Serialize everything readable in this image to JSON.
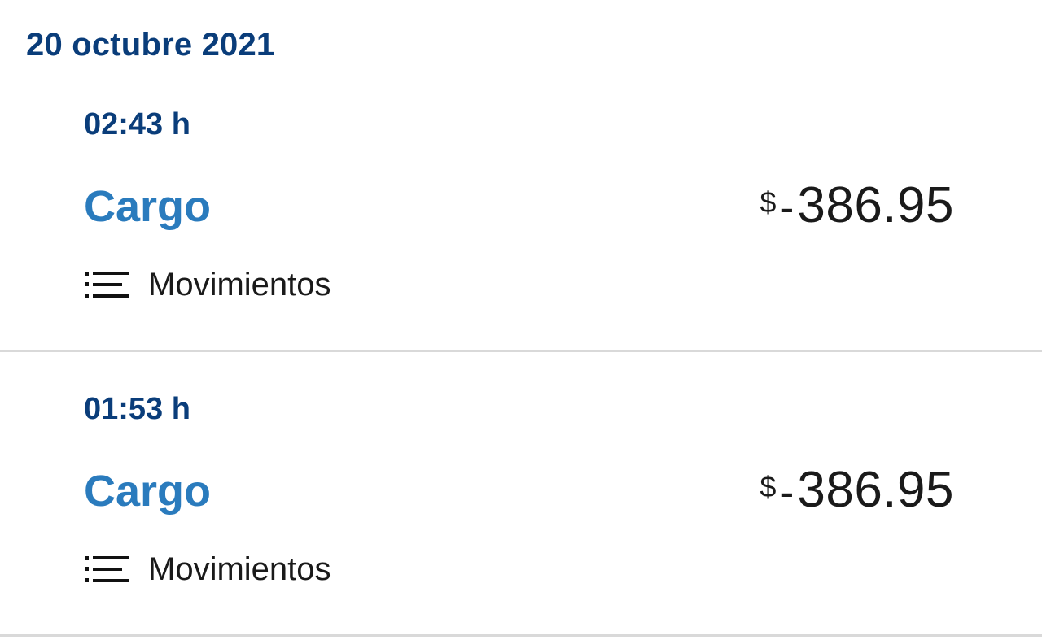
{
  "date_header": "20 octubre 2021",
  "transactions": [
    {
      "time": "02:43 h",
      "type": "Cargo",
      "amount_currency": "$",
      "amount_sign": "-",
      "amount_value": "386.95",
      "link_label": "Movimientos",
      "link_icon": "list-icon"
    },
    {
      "time": "01:53 h",
      "type": "Cargo",
      "amount_currency": "$",
      "amount_sign": "-",
      "amount_value": "386.95",
      "link_label": "Movimientos",
      "link_icon": "list-icon"
    }
  ],
  "colors": {
    "date_header": "#0a3d7a",
    "time": "#0a3d7a",
    "type": "#2a7bbd",
    "amount": "#1a1a1a",
    "divider": "#d9d9d9",
    "background": "#ffffff"
  }
}
